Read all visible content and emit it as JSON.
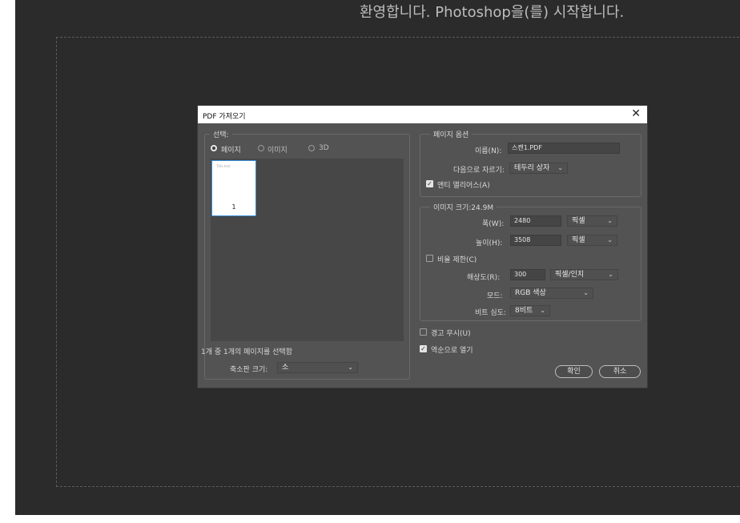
{
  "welcome_text": "환영합니다. Photoshop을(를) 시작합니다.",
  "dialog": {
    "title": "PDF 가져오기",
    "select_group": {
      "legend": "선택:",
      "radio_page": "페이지",
      "radio_image": "이미지",
      "radio_3d": "3D",
      "thumbnail_page_number": "1",
      "thumbnail_tiny_text": "Title text",
      "status_text": "1개 중 1개의 페이지를 선택함",
      "thumb_size_label": "축소판 크기:",
      "thumb_size_value": "소"
    },
    "page_options": {
      "legend": "페이지 옵션",
      "name_label": "이름(N):",
      "name_value": "스캔1.PDF",
      "crop_label": "다음으로 자르기:",
      "crop_value": "테두리 상자",
      "antialias_label": "앤티 앨리어스(A)"
    },
    "image_size": {
      "legend": "이미지 크기:24.9M",
      "width_label": "폭(W):",
      "width_value": "2480",
      "width_unit": "픽셀",
      "height_label": "높이(H):",
      "height_value": "3508",
      "height_unit": "픽셀",
      "constrain_label": "비율 제한(C)",
      "resolution_label": "해상도(R):",
      "resolution_value": "300",
      "resolution_unit": "픽셀/인치",
      "mode_label": "모드:",
      "mode_value": "RGB 색상",
      "depth_label": "비트 심도:",
      "depth_value": "8비트"
    },
    "suppress_warnings_label": "경고 무시(U)",
    "reverse_order_label": "역순으로 열기",
    "ok_label": "확인",
    "cancel_label": "취소"
  }
}
